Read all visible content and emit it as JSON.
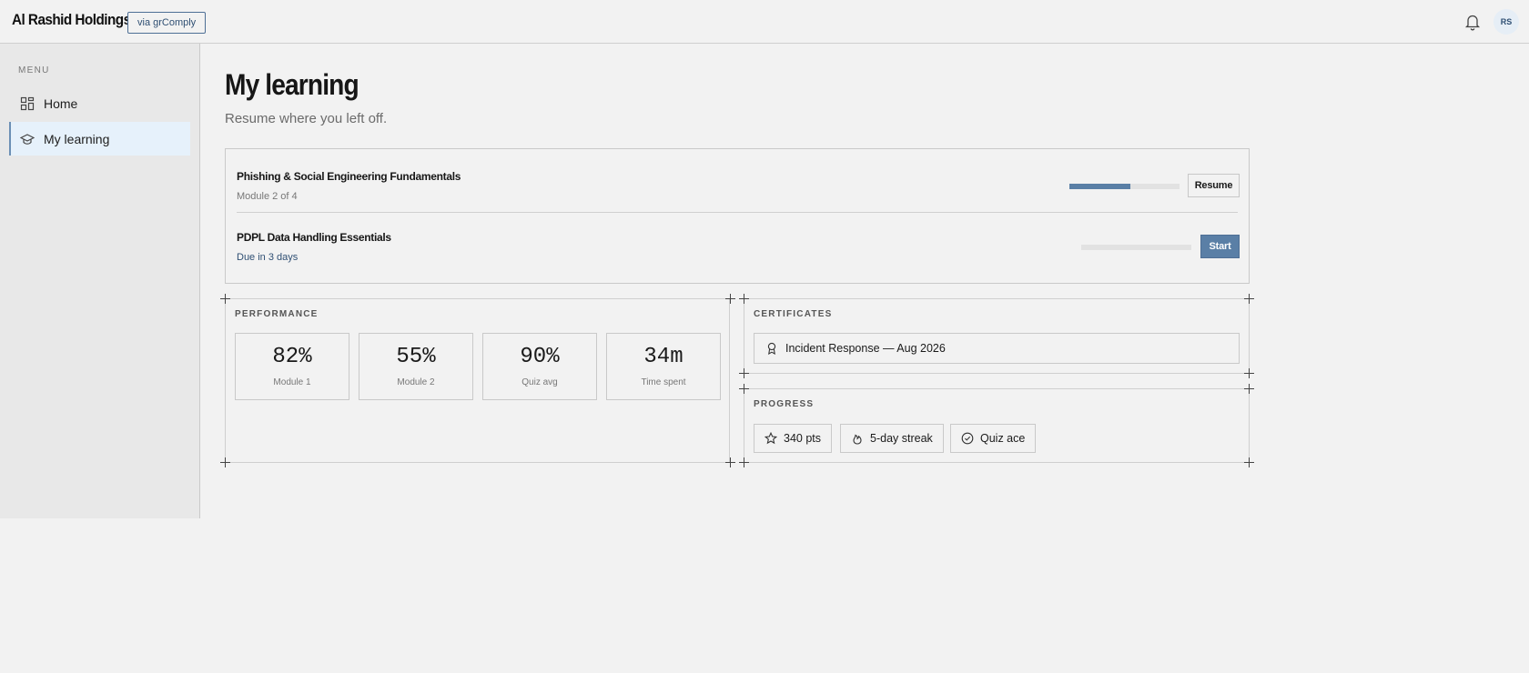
{
  "header": {
    "org_name": "Al Rashid Holdings",
    "via_label": "via grComply",
    "avatar_initials": "RS",
    "icons": {
      "notifications": "bell-icon"
    }
  },
  "sidebar": {
    "menu_label": "MENU",
    "items": [
      {
        "label": "Home",
        "icon": "grid-icon",
        "active": false
      },
      {
        "label": "My learning",
        "icon": "graduation-cap-icon",
        "active": true
      }
    ]
  },
  "main": {
    "title": "My learning",
    "subtitle": "Resume where you left off.",
    "courses": [
      {
        "title": "Phishing & Social Engineering Fundamentals",
        "meta": "Module 2 of 4",
        "progress": 0.55,
        "action": "Resume"
      },
      {
        "title": "PDPL Data Handling Essentials",
        "meta": "Due in 3 days",
        "progress": 0.0,
        "action": "Start"
      }
    ],
    "performance": {
      "label": "PERFORMANCE",
      "stats": [
        {
          "value": "82%",
          "label": "Module 1"
        },
        {
          "value": "55%",
          "label": "Module 2"
        },
        {
          "value": "90%",
          "label": "Quiz avg"
        },
        {
          "value": "34m",
          "label": "Time spent"
        }
      ]
    },
    "certificates": {
      "label": "CERTIFICATES",
      "items": [
        {
          "title": "Incident Response — Aug 2026",
          "icon": "award-ribbon-icon"
        }
      ]
    },
    "progress": {
      "label": "PROGRESS",
      "badges": [
        {
          "label": "340 pts",
          "icon": "star-icon"
        },
        {
          "label": "5-day streak",
          "icon": "flame-icon"
        },
        {
          "label": "Quiz ace",
          "icon": "check-circle-icon"
        }
      ]
    }
  },
  "colors": {
    "accent": "#5a7fa6",
    "accent_dark": "#2f4f73",
    "background": "#f2f2f2",
    "sidebar_bg": "#e8e8e8",
    "active_item_bg": "#e6f1fb"
  }
}
